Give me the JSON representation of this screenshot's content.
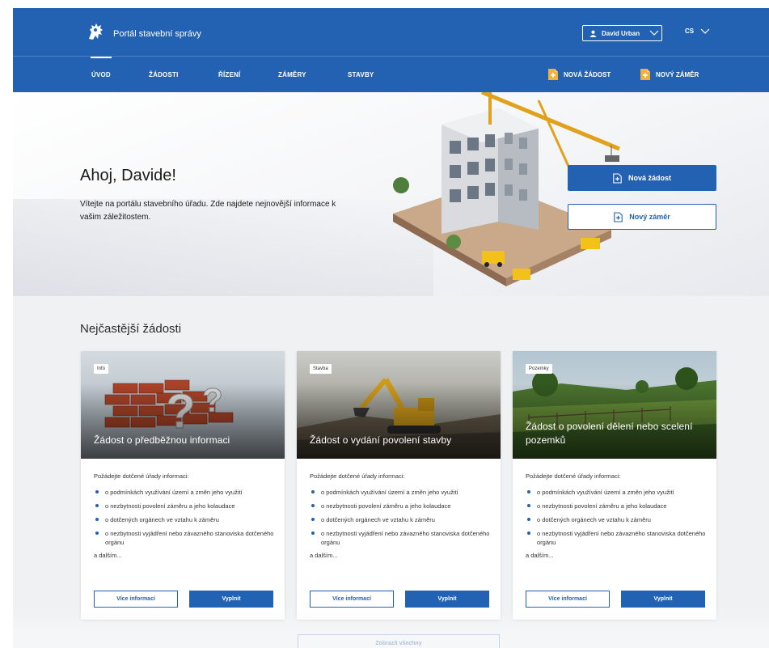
{
  "header": {
    "portal_title": "Portál stavební správy",
    "user_name": "David Urban",
    "language": "CS",
    "nav": [
      {
        "label": "ÚVOD",
        "active": true
      },
      {
        "label": "ŽÁDOSTI",
        "active": false
      },
      {
        "label": "ŘÍZENÍ",
        "active": false
      },
      {
        "label": "ZÁMĚRY",
        "active": false
      },
      {
        "label": "STAVBY",
        "active": false
      }
    ],
    "cta_new_request": "NOVÁ ŽÁDOST",
    "cta_new_plan": "NOVÝ ZÁMĚR"
  },
  "hero": {
    "greeting": "Ahoj, Davide!",
    "intro": "Vítejte na portálu stavebního úřadu. Zde najdete nejnovější informace k vašim záležitostem.",
    "btn_new_request": "Nová žádost",
    "btn_new_plan": "Nový záměr"
  },
  "section": {
    "title": "Nejčastější žádosti",
    "show_all": "Zobrazit všechny"
  },
  "cards": [
    {
      "tag": "Info",
      "title": "Žádost o předběžnou informaci",
      "intro": "Požádejte dotčené úřady informaci:",
      "bullets": [
        "o podmínkách využívání území a změn jeho využití",
        "o nezbytnosti povolení záměru a jeho kolaudace",
        "o dotčených orgánech ve vztahu k záměru",
        "o nezbytnosti vyjádření nebo závazného stanoviska dotčeného orgánu"
      ],
      "more": "a dalším...",
      "btn_more": "Více informací",
      "btn_fill": "Vyplnit"
    },
    {
      "tag": "Stavba",
      "title": "Žádost o vydání povolení stavby",
      "intro": "Požádejte dotčené úřady informaci:",
      "bullets": [
        "o podmínkách využívání území a změn jeho využití",
        "o nezbytnosti povolení záměru a jeho kolaudace",
        "o dotčených orgánech ve vztahu k záměru",
        "o nezbytnosti vyjádření nebo závazného stanoviska dotčeného orgánu"
      ],
      "more": "a dalším...",
      "btn_more": "Více informací",
      "btn_fill": "Vyplnit"
    },
    {
      "tag": "Pozemky",
      "title": "Žádost o povolení dělení nebo scelení pozemků",
      "intro": "Požádejte dotčené úřady informaci:",
      "bullets": [
        "o podmínkách využívání území a změn jeho využití",
        "o nezbytnosti povolení záměru a jeho kolaudace",
        "o dotčených orgánech ve vztahu k záměru",
        "o nezbytnosti vyjádření nebo závazného stanoviska dotčeného orgánu"
      ],
      "more": "a dalším...",
      "btn_more": "Více informací",
      "btn_fill": "Vyplnit"
    }
  ],
  "colors": {
    "primary": "#2362b3",
    "page_bg": "#f0f1f3",
    "text": "#1b1b1b"
  },
  "icons": [
    "lion-emblem-icon",
    "user-icon",
    "chevron-down-icon",
    "document-add-icon"
  ]
}
